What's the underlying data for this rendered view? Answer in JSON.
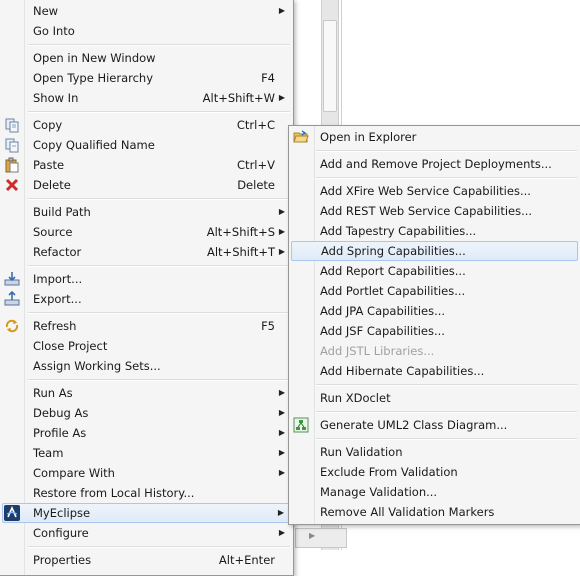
{
  "context_menu": {
    "items": [
      {
        "label": "New",
        "shortcut": "",
        "submenu": true
      },
      {
        "label": "Go Into",
        "shortcut": "",
        "submenu": false
      },
      {
        "label": "Open in New Window",
        "shortcut": "",
        "submenu": false
      },
      {
        "label": "Open Type Hierarchy",
        "shortcut": "F4",
        "submenu": false
      },
      {
        "label": "Show In",
        "shortcut": "Alt+Shift+W",
        "submenu": true
      },
      {
        "label": "Copy",
        "shortcut": "Ctrl+C",
        "submenu": false,
        "icon": "copy-icon"
      },
      {
        "label": "Copy Qualified Name",
        "shortcut": "",
        "submenu": false,
        "icon": "copy-qualified-icon"
      },
      {
        "label": "Paste",
        "shortcut": "Ctrl+V",
        "submenu": false,
        "icon": "paste-icon"
      },
      {
        "label": "Delete",
        "shortcut": "Delete",
        "submenu": false,
        "icon": "delete-icon"
      },
      {
        "label": "Build Path",
        "shortcut": "",
        "submenu": true
      },
      {
        "label": "Source",
        "shortcut": "Alt+Shift+S",
        "submenu": true
      },
      {
        "label": "Refactor",
        "shortcut": "Alt+Shift+T",
        "submenu": true
      },
      {
        "label": "Import...",
        "shortcut": "",
        "submenu": false,
        "icon": "import-icon"
      },
      {
        "label": "Export...",
        "shortcut": "",
        "submenu": false,
        "icon": "export-icon"
      },
      {
        "label": "Refresh",
        "shortcut": "F5",
        "submenu": false,
        "icon": "refresh-icon"
      },
      {
        "label": "Close Project",
        "shortcut": "",
        "submenu": false
      },
      {
        "label": "Assign Working Sets...",
        "shortcut": "",
        "submenu": false
      },
      {
        "label": "Run As",
        "shortcut": "",
        "submenu": true
      },
      {
        "label": "Debug As",
        "shortcut": "",
        "submenu": true
      },
      {
        "label": "Profile As",
        "shortcut": "",
        "submenu": true
      },
      {
        "label": "Team",
        "shortcut": "",
        "submenu": true
      },
      {
        "label": "Compare With",
        "shortcut": "",
        "submenu": true
      },
      {
        "label": "Restore from Local History...",
        "shortcut": "",
        "submenu": false
      },
      {
        "label": "MyEclipse",
        "shortcut": "",
        "submenu": true,
        "icon": "myeclipse-icon",
        "highlighted": true
      },
      {
        "label": "Configure",
        "shortcut": "",
        "submenu": true
      },
      {
        "label": "Properties",
        "shortcut": "Alt+Enter",
        "submenu": false
      }
    ]
  },
  "myeclipse_submenu": {
    "items": [
      {
        "label": "Open in Explorer",
        "icon": "folder-open-icon"
      },
      {
        "label": "Add and Remove Project Deployments..."
      },
      {
        "label": "Add XFire Web Service Capabilities..."
      },
      {
        "label": "Add REST Web Service Capabilities..."
      },
      {
        "label": "Add Tapestry Capabilities..."
      },
      {
        "label": "Add Spring Capabilities...",
        "highlighted": true
      },
      {
        "label": "Add Report Capabilities..."
      },
      {
        "label": "Add Portlet Capabilities..."
      },
      {
        "label": "Add JPA Capabilities..."
      },
      {
        "label": "Add JSF Capabilities..."
      },
      {
        "label": "Add JSTL Libraries...",
        "disabled": true
      },
      {
        "label": "Add Hibernate Capabilities..."
      },
      {
        "label": "Run XDoclet"
      },
      {
        "label": "Generate UML2 Class Diagram...",
        "icon": "uml-diagram-icon"
      },
      {
        "label": "Run Validation"
      },
      {
        "label": "Exclude From Validation"
      },
      {
        "label": "Manage Validation..."
      },
      {
        "label": "Remove All Validation Markers"
      }
    ]
  },
  "colors": {
    "menu_bg": "#f5f5f5",
    "highlight_border": "#a8c6ee",
    "disabled_text": "#a0a0a0"
  }
}
